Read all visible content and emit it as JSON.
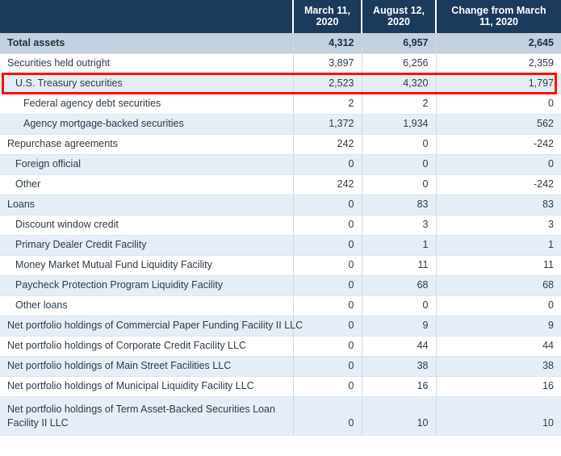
{
  "table": {
    "columns": [
      {
        "key": "label",
        "label": ""
      },
      {
        "key": "mar11",
        "label": "March 11, 2020"
      },
      {
        "key": "aug12",
        "label": "August 12, 2020"
      },
      {
        "key": "change",
        "label": "Change from March 11, 2020"
      }
    ],
    "rows": [
      {
        "label": "Total assets",
        "indent": 0,
        "mar11": "4,312",
        "aug12": "6,957",
        "change": "2,645",
        "style": "total"
      },
      {
        "label": "Securities held outright",
        "indent": 0,
        "mar11": "3,897",
        "aug12": "6,256",
        "change": "2,359",
        "style": "white"
      },
      {
        "label": "U.S. Treasury securities",
        "indent": 1,
        "mar11": "2,523",
        "aug12": "4,320",
        "change": "1,797",
        "style": "box"
      },
      {
        "label": "Federal agency debt securities",
        "indent": 2,
        "mar11": "2",
        "aug12": "2",
        "change": "0",
        "style": "white"
      },
      {
        "label": "Agency mortgage-backed securities",
        "indent": 2,
        "mar11": "1,372",
        "aug12": "1,934",
        "change": "562",
        "style": "tint"
      },
      {
        "label": "Repurchase agreements",
        "indent": 0,
        "mar11": "242",
        "aug12": "0",
        "change": "-242",
        "style": "white"
      },
      {
        "label": "Foreign official",
        "indent": 1,
        "mar11": "0",
        "aug12": "0",
        "change": "0",
        "style": "tint"
      },
      {
        "label": "Other",
        "indent": 1,
        "mar11": "242",
        "aug12": "0",
        "change": "-242",
        "style": "white"
      },
      {
        "label": "Loans",
        "indent": 0,
        "mar11": "0",
        "aug12": "83",
        "change": "83",
        "style": "tint"
      },
      {
        "label": "Discount window credit",
        "indent": 1,
        "mar11": "0",
        "aug12": "3",
        "change": "3",
        "style": "white"
      },
      {
        "label": "Primary Dealer Credit Facility",
        "indent": 1,
        "mar11": "0",
        "aug12": "1",
        "change": "1",
        "style": "tint"
      },
      {
        "label": "Money Market Mutual Fund Liquidity Facility",
        "indent": 1,
        "mar11": "0",
        "aug12": "11",
        "change": "11",
        "style": "white"
      },
      {
        "label": "Paycheck Protection Program Liquidity Facility",
        "indent": 1,
        "mar11": "0",
        "aug12": "68",
        "change": "68",
        "style": "tint"
      },
      {
        "label": "Other loans",
        "indent": 1,
        "mar11": "0",
        "aug12": "0",
        "change": "0",
        "style": "white"
      },
      {
        "label": "Net portfolio holdings of Commercial Paper Funding Facility II LLC",
        "indent": 0,
        "mar11": "0",
        "aug12": "9",
        "change": "9",
        "style": "tint"
      },
      {
        "label": "Net portfolio holdings of Corporate Credit Facility LLC",
        "indent": 0,
        "mar11": "0",
        "aug12": "44",
        "change": "44",
        "style": "white"
      },
      {
        "label": "Net portfolio holdings of Main Street Facilities LLC",
        "indent": 0,
        "mar11": "0",
        "aug12": "38",
        "change": "38",
        "style": "tint"
      },
      {
        "label": "Net portfolio holdings of Municipal Liquidity Facility LLC",
        "indent": 0,
        "mar11": "0",
        "aug12": "16",
        "change": "16",
        "style": "white"
      },
      {
        "label": "Net portfolio holdings of Term Asset-Backed Securities Loan Facility II LLC",
        "indent": 0,
        "mar11": "0",
        "aug12": "10",
        "change": "10",
        "style": "tint",
        "tall": true
      }
    ]
  },
  "annotation": {
    "highlight_row_label": "U.S. Treasury securities",
    "highlight_color": "#fb1200"
  },
  "colors": {
    "header_bg": "#1b3a5c",
    "header_text": "#ffffff",
    "total_row_bg": "#c3d0dd",
    "tint_row_bg": "#e5eef7",
    "white_row_bg": "#ffffff",
    "body_text": "#2d3a45",
    "grid_line": "#cfd8e2"
  }
}
